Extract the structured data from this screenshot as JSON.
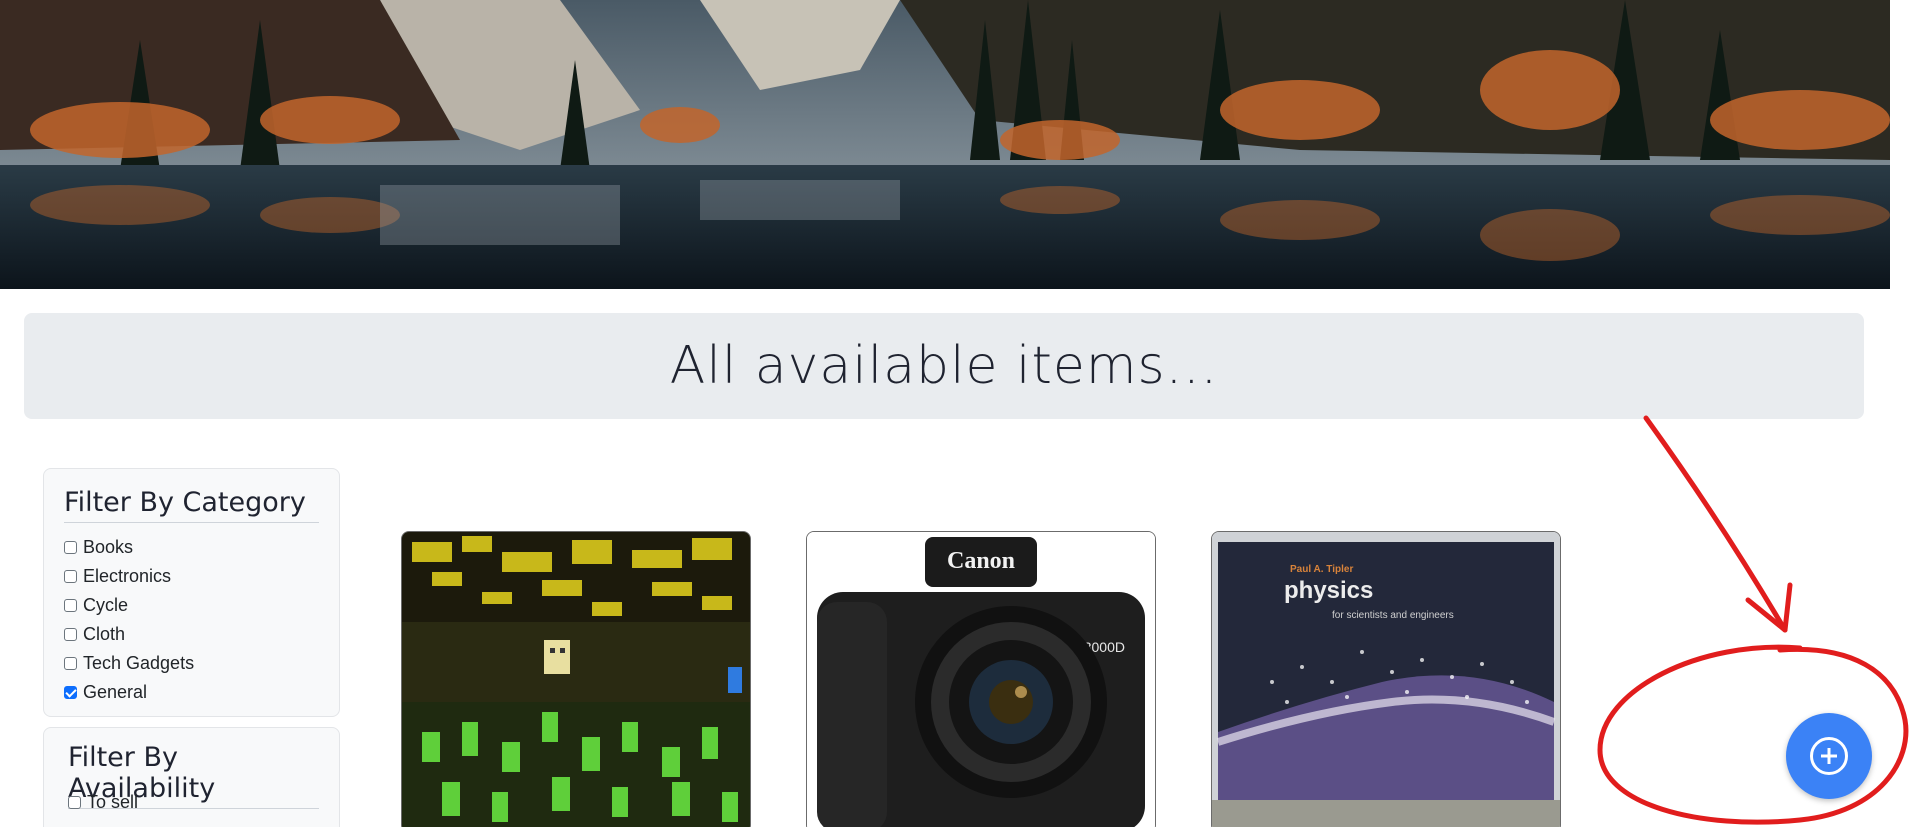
{
  "page": {
    "heading": "All available items..."
  },
  "filters": {
    "category": {
      "title": "Filter By Category",
      "options": [
        {
          "label": "Books",
          "checked": false
        },
        {
          "label": "Electronics",
          "checked": false
        },
        {
          "label": "Cycle",
          "checked": false
        },
        {
          "label": "Cloth",
          "checked": false
        },
        {
          "label": "Tech Gadgets",
          "checked": false
        },
        {
          "label": "General",
          "checked": true
        }
      ]
    },
    "availability": {
      "title": "Filter By Availability",
      "options": [
        {
          "label": "To sell",
          "checked": false
        }
      ]
    }
  },
  "items": [
    {
      "image": "minecraft-scene-image"
    },
    {
      "image": "canon-camera-image",
      "brand_text": "Canon",
      "model_text": "EOS 3000D"
    },
    {
      "image": "physics-book-image",
      "author_text": "Paul A. Tipler",
      "title_text": "physics",
      "subtitle_text": "for scientists and engineers"
    }
  ],
  "fab": {
    "icon": "plus-circle-icon",
    "color": "#3b82f6"
  },
  "colors": {
    "title_bar": "#e9ecef",
    "filter_bg": "#f8f9fa",
    "checkbox_checked": "#0d6efd",
    "annotation_red": "#e11d1d"
  }
}
